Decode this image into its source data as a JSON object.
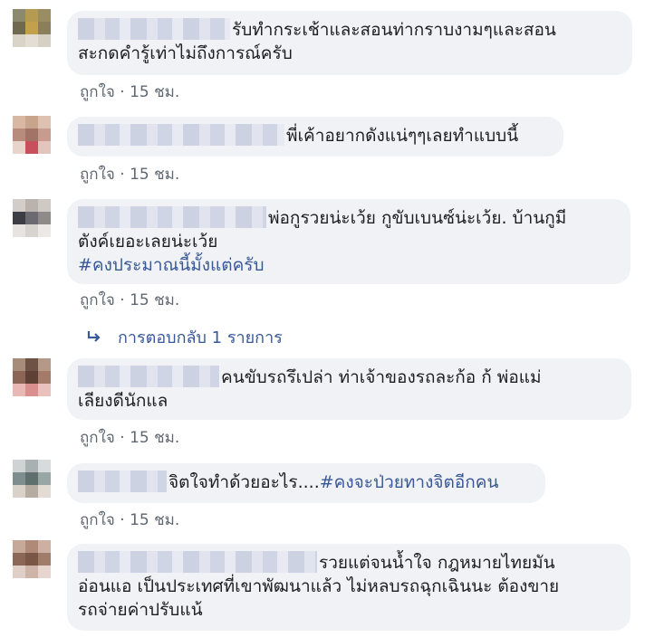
{
  "comments": [
    {
      "text_lines": [
        "รับทำกระเช้าและสอนท่ากราบงามๆและสอน",
        "สะกดคำรู้เท่าไม่ถึงการณ์ครับ"
      ],
      "like_label": "ถูกใจ",
      "separator": "·",
      "time": "15 ชม."
    },
    {
      "text_lines": [
        "พี่เค้าอยากดังแน่ๆๆเลยทำแบบนี้"
      ],
      "like_label": "ถูกใจ",
      "separator": "·",
      "time": "15 ชม."
    },
    {
      "text_lines": [
        "พ่อกูรวยน่ะเว้ย กูขับเบนซ์น่ะเว้ย. บ้านกูมี",
        "ตังค์เยอะเลยน่ะเว้ย"
      ],
      "hashtag": "#คงประมาณนี้มั้งแต่ครับ",
      "like_label": "ถูกใจ",
      "separator": "·",
      "time": "15 ชม.",
      "replies_label": "การตอบกลับ 1 รายการ"
    },
    {
      "text_lines": [
        "คนขับรถรึเปล่า ท่าเจ้าของรถละก้อ ก้ พ่อแม่",
        "เลียงดีนักแล"
      ],
      "like_label": "ถูกใจ",
      "separator": "·",
      "time": "15 ชม."
    },
    {
      "text_lines": [
        "จิตใจทำด้วยอะไร...."
      ],
      "hashtag": "#คงจะป่วยทางจิตอีกคน",
      "like_label": "ถูกใจ",
      "separator": "·",
      "time": "15 ชม."
    },
    {
      "text_lines": [
        "รวยแต่จนน้ำใจ กฎหมายไทยมัน",
        "อ่อนแอ เป็นประเทศที่เขาพัฒนาแล้ว ไม่หลบรถฉุกเฉินนะ ต้องขาย",
        "รถจ่ายค่าปรับแน้"
      ]
    }
  ],
  "icons": {
    "reply_arrow": "reply-arrow-icon"
  },
  "colors": {
    "bubble": "#f0f2f5",
    "link": "#385898",
    "meta": "#606770",
    "text": "#1c1e21"
  }
}
